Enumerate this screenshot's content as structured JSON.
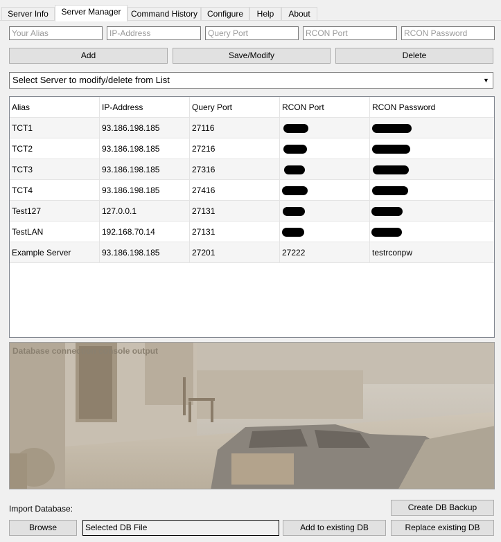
{
  "tabs": [
    "Server Info",
    "Server Manager",
    "Command History",
    "Configure",
    "Help",
    "About"
  ],
  "active_tab": "Server Manager",
  "inputs": {
    "alias": {
      "placeholder": "Your Alias",
      "value": ""
    },
    "ip": {
      "placeholder": "IP-Address",
      "value": ""
    },
    "query_port": {
      "placeholder": "Query Port",
      "value": ""
    },
    "rcon_port": {
      "placeholder": "RCON Port",
      "value": ""
    },
    "rcon_password": {
      "placeholder": "RCON Password",
      "value": ""
    }
  },
  "buttons": {
    "add": "Add",
    "save_modify": "Save/Modify",
    "delete": "Delete",
    "create_backup": "Create DB Backup",
    "browse": "Browse",
    "add_existing": "Add to existing DB",
    "replace_existing": "Replace existing DB"
  },
  "server_select": {
    "value": "Select Server to modify/delete from List"
  },
  "table": {
    "columns": [
      "Alias",
      "IP-Address",
      "Query Port",
      "RCON Port",
      "RCON Password"
    ],
    "rows": [
      {
        "alias": "TCT1",
        "ip": "93.186.198.185",
        "query_port": "27116",
        "rcon_port": "",
        "rcon_password": "",
        "redacted": true
      },
      {
        "alias": "TCT2",
        "ip": "93.186.198.185",
        "query_port": "27216",
        "rcon_port": "",
        "rcon_password": "",
        "redacted": true
      },
      {
        "alias": "TCT3",
        "ip": "93.186.198.185",
        "query_port": "27316",
        "rcon_port": "",
        "rcon_password": "",
        "redacted": true
      },
      {
        "alias": "TCT4",
        "ip": "93.186.198.185",
        "query_port": "27416",
        "rcon_port": "",
        "rcon_password": "",
        "redacted": true
      },
      {
        "alias": "Test127",
        "ip": "127.0.0.1",
        "query_port": "27131",
        "rcon_port": "",
        "rcon_password": "",
        "redacted": true
      },
      {
        "alias": "TestLAN",
        "ip": "192.168.70.14",
        "query_port": "27131",
        "rcon_port": "",
        "rcon_password": "",
        "redacted": true
      },
      {
        "alias": "Example Server",
        "ip": "93.186.198.185",
        "query_port": "27201",
        "rcon_port": "27222",
        "rcon_password": "testrconpw",
        "redacted": false
      }
    ]
  },
  "console": {
    "title": "Database connection console output"
  },
  "import": {
    "label": "Import Database:",
    "file_value": "Selected DB File"
  },
  "icons": {
    "dropdown": "chevron-down-icon"
  }
}
